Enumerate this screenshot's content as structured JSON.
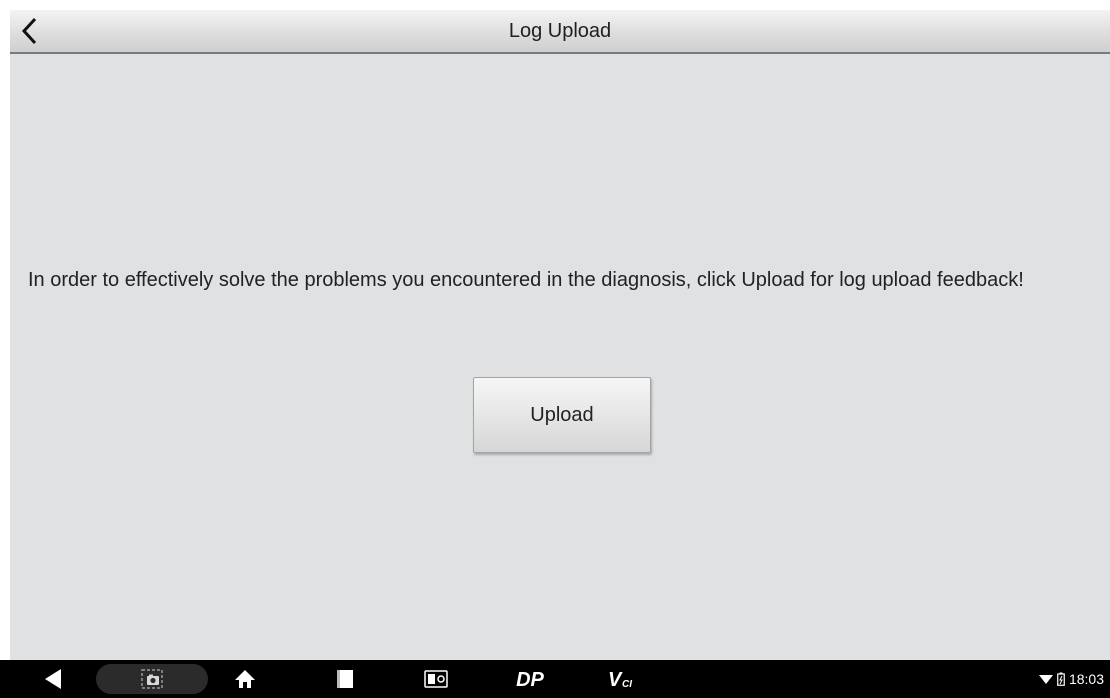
{
  "header": {
    "title": "Log Upload",
    "back_icon": "chevron-left-icon"
  },
  "main": {
    "message": "In order to effectively solve the problems you encountered in the diagnosis, click Upload for log upload feedback!",
    "upload_label": "Upload"
  },
  "navbar": {
    "icons": [
      "back-triangle-icon",
      "screenshot-icon",
      "home-icon",
      "recent-apps-icon",
      "app-switch-icon",
      "dp-icon",
      "vci-icon"
    ],
    "dp_label": "DP",
    "vci_label": "V",
    "vci_sub": "CI",
    "status": {
      "wifi_icon": "wifi-icon",
      "battery_icon": "battery-icon",
      "time": "18:03"
    }
  },
  "colors": {
    "app_background": "#dfe1e3",
    "navbar_background": "#000000"
  }
}
